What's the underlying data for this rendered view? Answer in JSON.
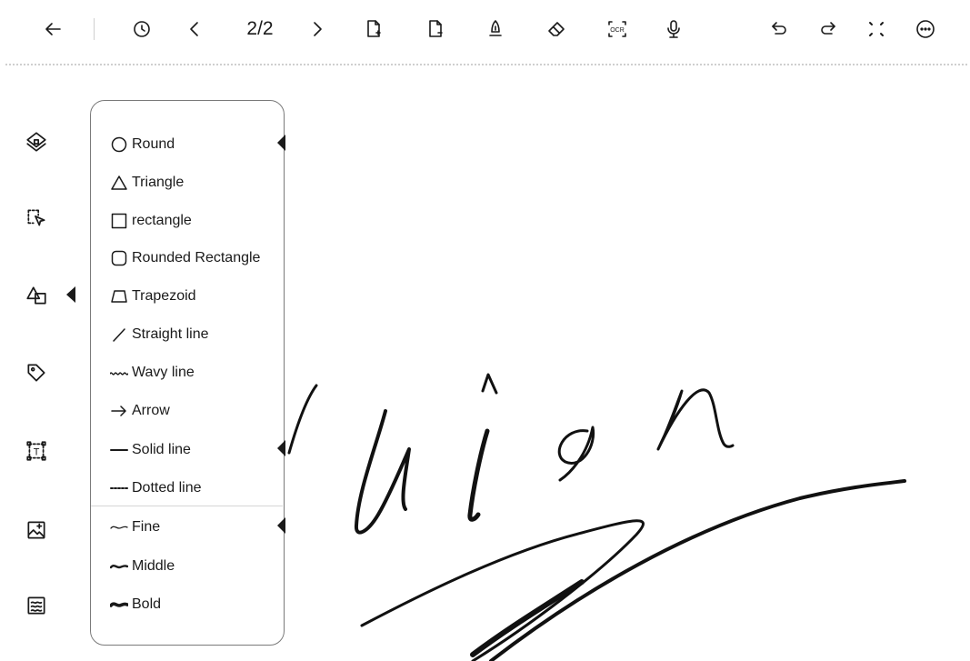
{
  "toolbar": {
    "back_icon": "back-arrow-icon",
    "page_indicator": "2/2",
    "items": [
      {
        "name": "history",
        "icon": "clock-icon"
      },
      {
        "name": "prev-page",
        "icon": "chevron-left-icon"
      },
      {
        "name": "next-page",
        "icon": "chevron-right-icon"
      },
      {
        "name": "add-page",
        "icon": "add-page-icon"
      },
      {
        "name": "delete-page",
        "icon": "remove-page-icon"
      },
      {
        "name": "pen",
        "icon": "pen-icon"
      },
      {
        "name": "eraser",
        "icon": "eraser-icon"
      },
      {
        "name": "ocr",
        "icon": "ocr-icon",
        "label": "OCR"
      },
      {
        "name": "record",
        "icon": "microphone-icon"
      },
      {
        "name": "undo",
        "icon": "undo-icon"
      },
      {
        "name": "redo",
        "icon": "redo-icon"
      },
      {
        "name": "fullscreen",
        "icon": "fullscreen-icon"
      },
      {
        "name": "more",
        "icon": "more-icon"
      }
    ]
  },
  "sidebar": {
    "items": [
      {
        "name": "layers",
        "icon": "layers-icon"
      },
      {
        "name": "lasso-select",
        "icon": "lasso-select-icon"
      },
      {
        "name": "shapes",
        "icon": "shapes-icon",
        "active": true
      },
      {
        "name": "tag",
        "icon": "tag-icon"
      },
      {
        "name": "text-box",
        "icon": "text-box-icon",
        "label": "T"
      },
      {
        "name": "insert-image",
        "icon": "image-icon"
      },
      {
        "name": "background",
        "icon": "background-pattern-icon"
      }
    ]
  },
  "shape_panel": {
    "shapes": [
      {
        "label": "Round",
        "icon": "circle-icon",
        "selected": true
      },
      {
        "label": "Triangle",
        "icon": "triangle-icon"
      },
      {
        "label": "rectangle",
        "icon": "rectangle-icon"
      },
      {
        "label": "Rounded Rectangle",
        "icon": "rounded-rectangle-icon"
      },
      {
        "label": "Trapezoid",
        "icon": "trapezoid-icon"
      },
      {
        "label": "Straight line",
        "icon": "straight-line-icon"
      },
      {
        "label": "Wavy line",
        "icon": "wavy-line-icon"
      },
      {
        "label": "Arrow",
        "icon": "arrow-icon"
      }
    ],
    "line_styles": [
      {
        "label": "Solid line",
        "icon": "solid-line-icon",
        "selected": true
      },
      {
        "label": "Dotted line",
        "icon": "dotted-line-icon"
      }
    ],
    "thickness": [
      {
        "label": "Fine",
        "icon": "fine-stroke-icon",
        "selected": true
      },
      {
        "label": "Middle",
        "icon": "middle-stroke-icon"
      },
      {
        "label": "Bold",
        "icon": "bold-stroke-icon"
      }
    ]
  },
  "colors": {
    "ink": "#1a1a1a",
    "background": "#ffffff",
    "panel_border": "#7a7a7a"
  }
}
